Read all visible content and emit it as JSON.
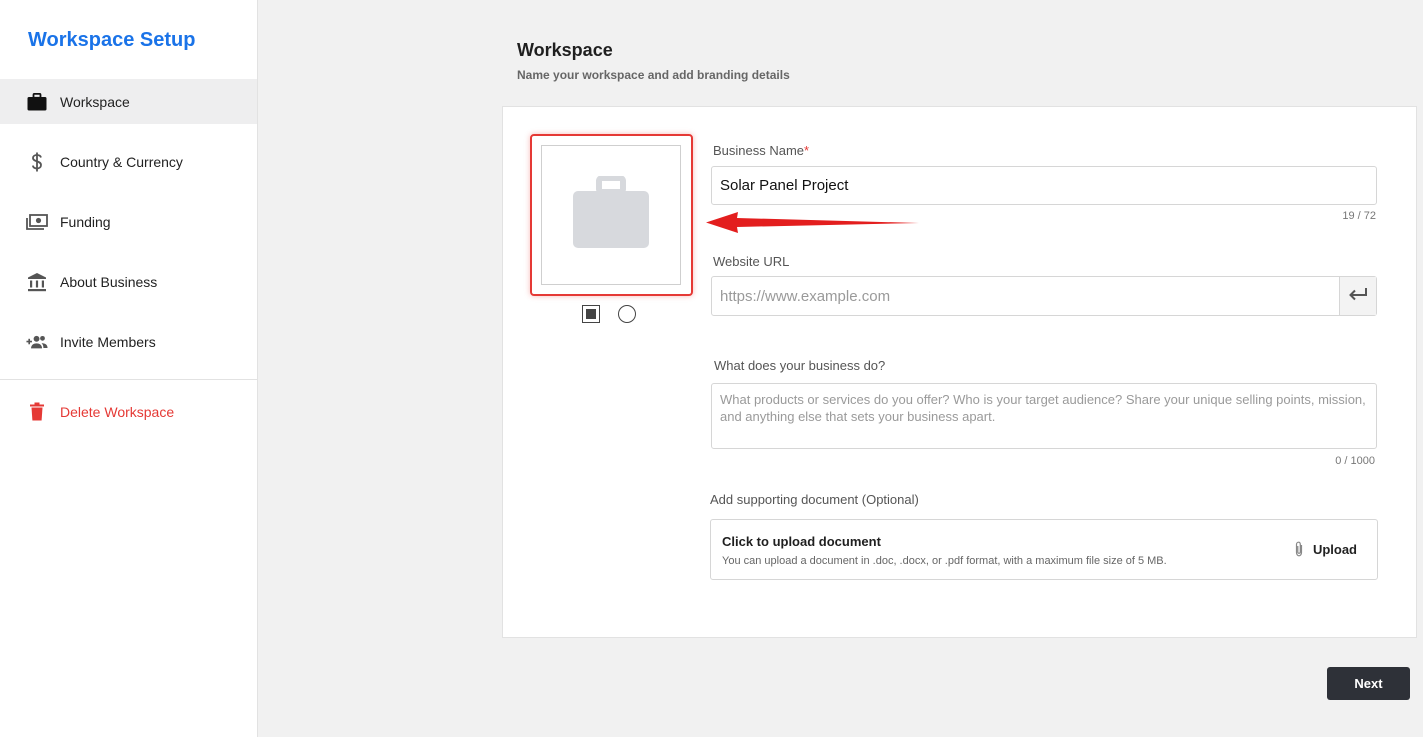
{
  "sidebar": {
    "title": "Workspace Setup",
    "items": [
      {
        "label": "Workspace",
        "icon": "briefcase-icon",
        "active": true
      },
      {
        "label": "Country & Currency",
        "icon": "dollar-icon"
      },
      {
        "label": "Funding",
        "icon": "money-icon"
      },
      {
        "label": "About Business",
        "icon": "bank-icon"
      },
      {
        "label": "Invite Members",
        "icon": "group-add-icon"
      }
    ],
    "delete_label": "Delete Workspace"
  },
  "header": {
    "title": "Workspace",
    "subtitle": "Name your workspace and add branding details"
  },
  "form": {
    "business_name": {
      "label": "Business Name",
      "required_mark": "*",
      "value": "Solar Panel Project",
      "counter": "19 / 72"
    },
    "website": {
      "label": "Website URL",
      "placeholder": "https://www.example.com"
    },
    "description": {
      "label": "What does your business do?",
      "placeholder": "What products or services do you offer? Who is your target audience? Share your unique selling points, mission, and anything else that sets your business apart.",
      "counter": "0 / 1000"
    },
    "document": {
      "label": "Add supporting document (Optional)",
      "title": "Click to upload document",
      "hint": "You can upload a document in .doc, .docx, or .pdf format, with a maximum file size of 5 MB.",
      "upload_label": "Upload"
    }
  },
  "logo": {
    "placeholder_icon": "briefcase-icon",
    "shapes": [
      "square",
      "circle"
    ],
    "selected_shape": "square"
  },
  "footer": {
    "next_label": "Next"
  },
  "colors": {
    "brand": "#1a73e8",
    "danger": "#e53935",
    "annotation": "#e31e1e",
    "primary_button": "#2e3138"
  }
}
